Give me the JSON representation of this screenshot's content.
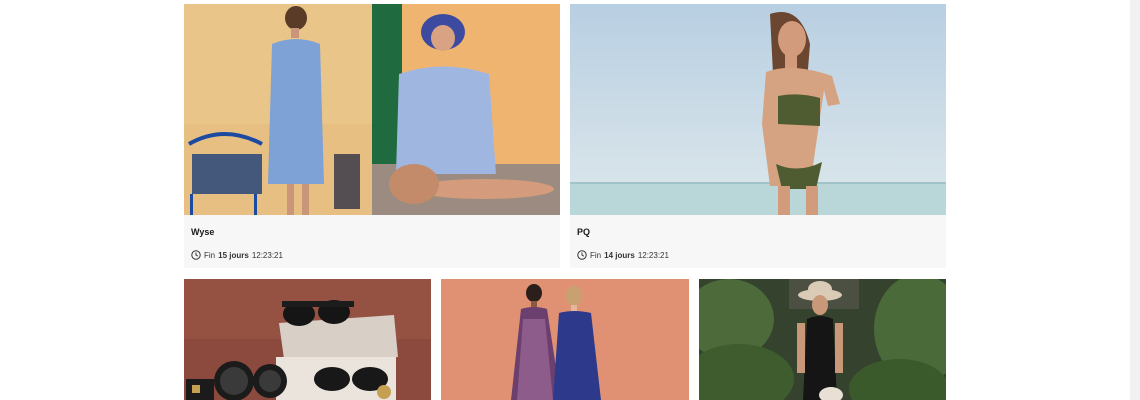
{
  "sales": [
    {
      "brand": "Wyse",
      "timer_prefix": "Fin",
      "days": "15 jours",
      "time": "12:23:21"
    },
    {
      "brand": "PQ",
      "timer_prefix": "Fin",
      "days": "14 jours",
      "time": "12:23:21"
    }
  ],
  "colors": {
    "card_background": "#f7f7f7",
    "text_primary": "#1a1a1a",
    "text_secondary": "#333333"
  },
  "icons": {
    "timer": "clock-icon"
  }
}
